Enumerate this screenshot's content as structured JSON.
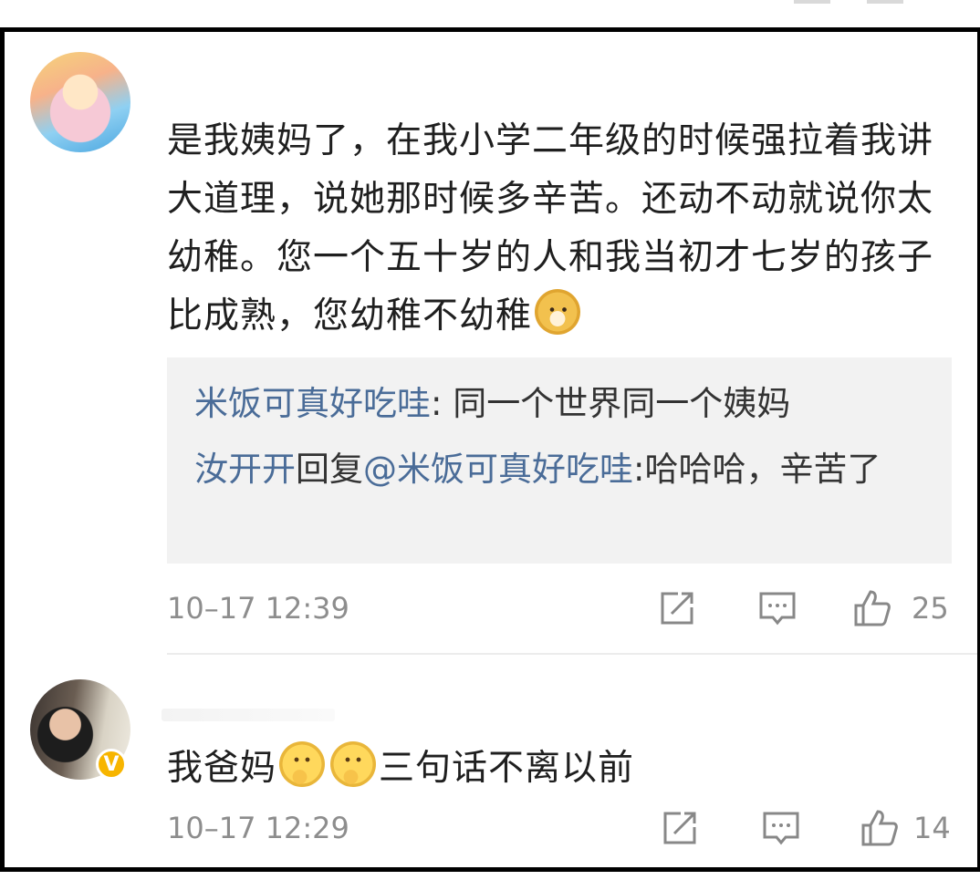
{
  "comments": [
    {
      "text_main": "是我姨妈了，在我小学二年级的时候强拉着我讲大道理，说她那时候多辛苦。还动不动就说你太幼稚。您一个五十岁的人和我当初才七岁的孩子比成熟，您幼稚不幼稚",
      "emoji": "doge-emoji",
      "replies": [
        {
          "user": "米饭可真好吃哇",
          "text": ": 同一个世界同一个姨妈"
        },
        {
          "user": "汝开开",
          "mid": "回复",
          "mention": "@米饭可真好吃哇",
          "text": ":哈哈哈，辛苦了"
        }
      ],
      "timestamp": "10–17 12:39",
      "likes": "25"
    },
    {
      "text_before": "我爸妈",
      "emoji": "thinking-emoji",
      "text_after": "三句话不离以前",
      "verified_badge": "V",
      "timestamp": "10–17 12:29",
      "likes": "14"
    }
  ],
  "icons": {
    "share": "share-icon",
    "comment": "comment-icon",
    "like": "thumbs-up-icon"
  },
  "colors": {
    "link": "#4a6c98",
    "meta": "#8d8d8d",
    "badge": "#f7b500",
    "reply_bg": "#f2f2f2"
  }
}
